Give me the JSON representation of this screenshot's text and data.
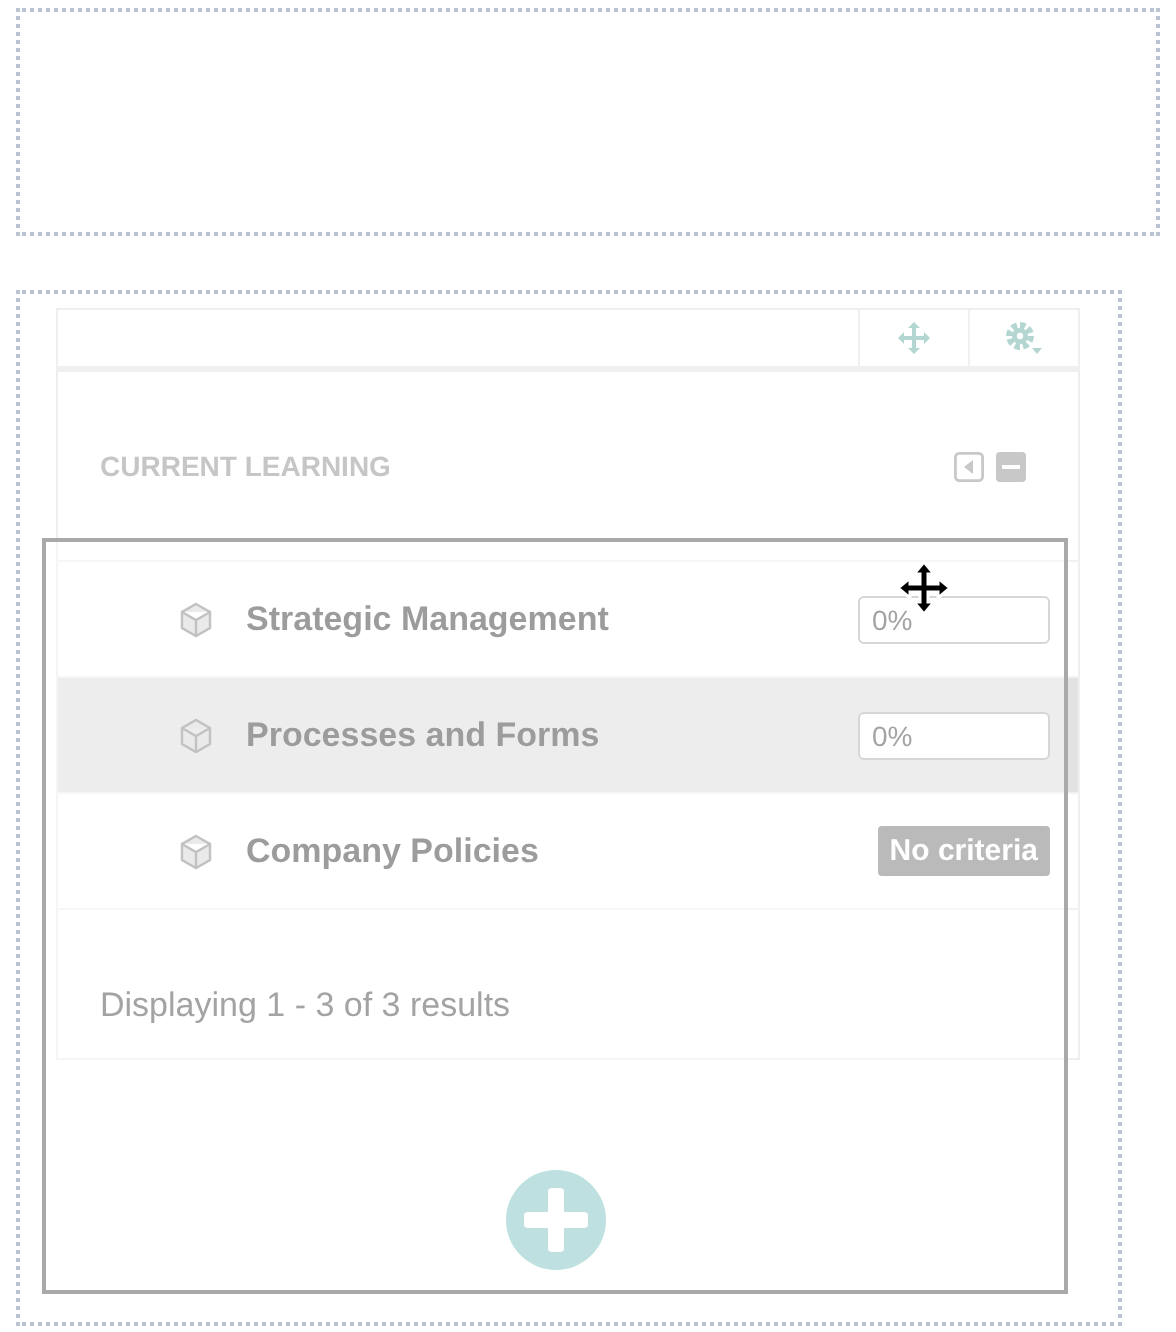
{
  "widget": {
    "title": "CURRENT LEARNING",
    "items": [
      {
        "name": "Strategic Management",
        "kind": "progress",
        "status": "0%",
        "selected": false
      },
      {
        "name": "Processes and Forms",
        "kind": "progress",
        "status": "0%",
        "selected": true
      },
      {
        "name": "Company Policies",
        "kind": "badge",
        "status": "No criteria",
        "selected": false
      }
    ],
    "footer": "Displaying 1 - 3 of 3 results"
  }
}
